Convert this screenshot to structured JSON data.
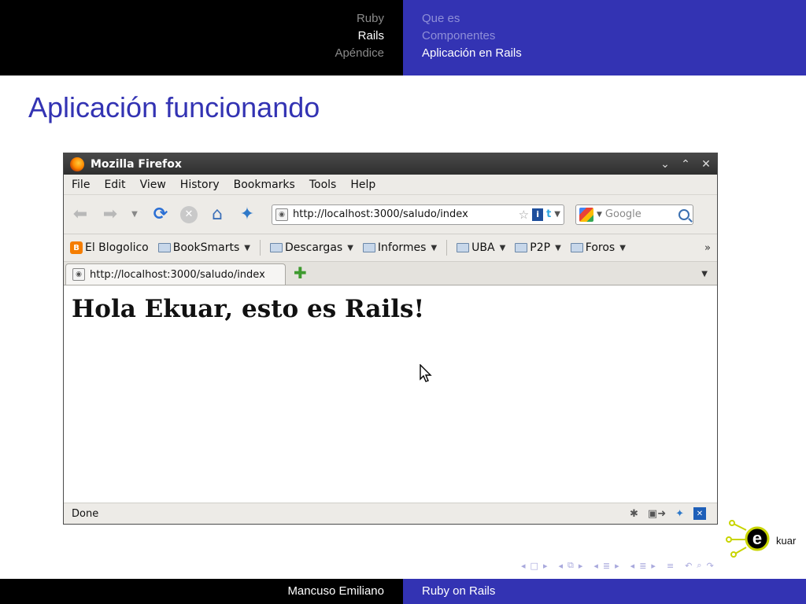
{
  "header": {
    "sections": [
      "Ruby",
      "Rails",
      "Apéndice"
    ],
    "subsections": [
      "Que es",
      "Componentes",
      "Aplicación en Rails"
    ]
  },
  "frame_title": "Aplicación funcionando",
  "browser": {
    "window_title": "Mozilla Firefox",
    "window_controls": [
      "chevron-down-icon",
      "chevron-up-icon",
      "close-icon"
    ],
    "menu": [
      "File",
      "Edit",
      "View",
      "History",
      "Bookmarks",
      "Tools",
      "Help"
    ],
    "url": "http://localhost:3000/saludo/index",
    "search_placeholder": "Google",
    "bookmarks": [
      {
        "label": "El Blogolico",
        "icon": "blogger-icon",
        "dropdown": false
      },
      {
        "label": "BookSmarts",
        "icon": "folder-icon",
        "dropdown": true
      },
      {
        "label": "Descargas",
        "icon": "folder-icon",
        "dropdown": true
      },
      {
        "label": "Informes",
        "icon": "folder-icon",
        "dropdown": true
      },
      {
        "label": "UBA",
        "icon": "folder-icon",
        "dropdown": true
      },
      {
        "label": "P2P",
        "icon": "folder-icon",
        "dropdown": true
      },
      {
        "label": "Foros",
        "icon": "folder-icon",
        "dropdown": true
      }
    ],
    "bookmarks_more": "»",
    "tab_title": "http://localhost:3000/saludo/index",
    "page_heading": "Hola Ekuar, esto es Rails!",
    "status": "Done"
  },
  "logo": {
    "wordmark": "kuar",
    "letter": "e",
    "accent": "#c8d400"
  },
  "footer": {
    "author": "Mancuso Emiliano",
    "title": "Ruby on Rails"
  },
  "colors": {
    "beamer_blue": "#3333b3",
    "beamer_black": "#000000"
  }
}
